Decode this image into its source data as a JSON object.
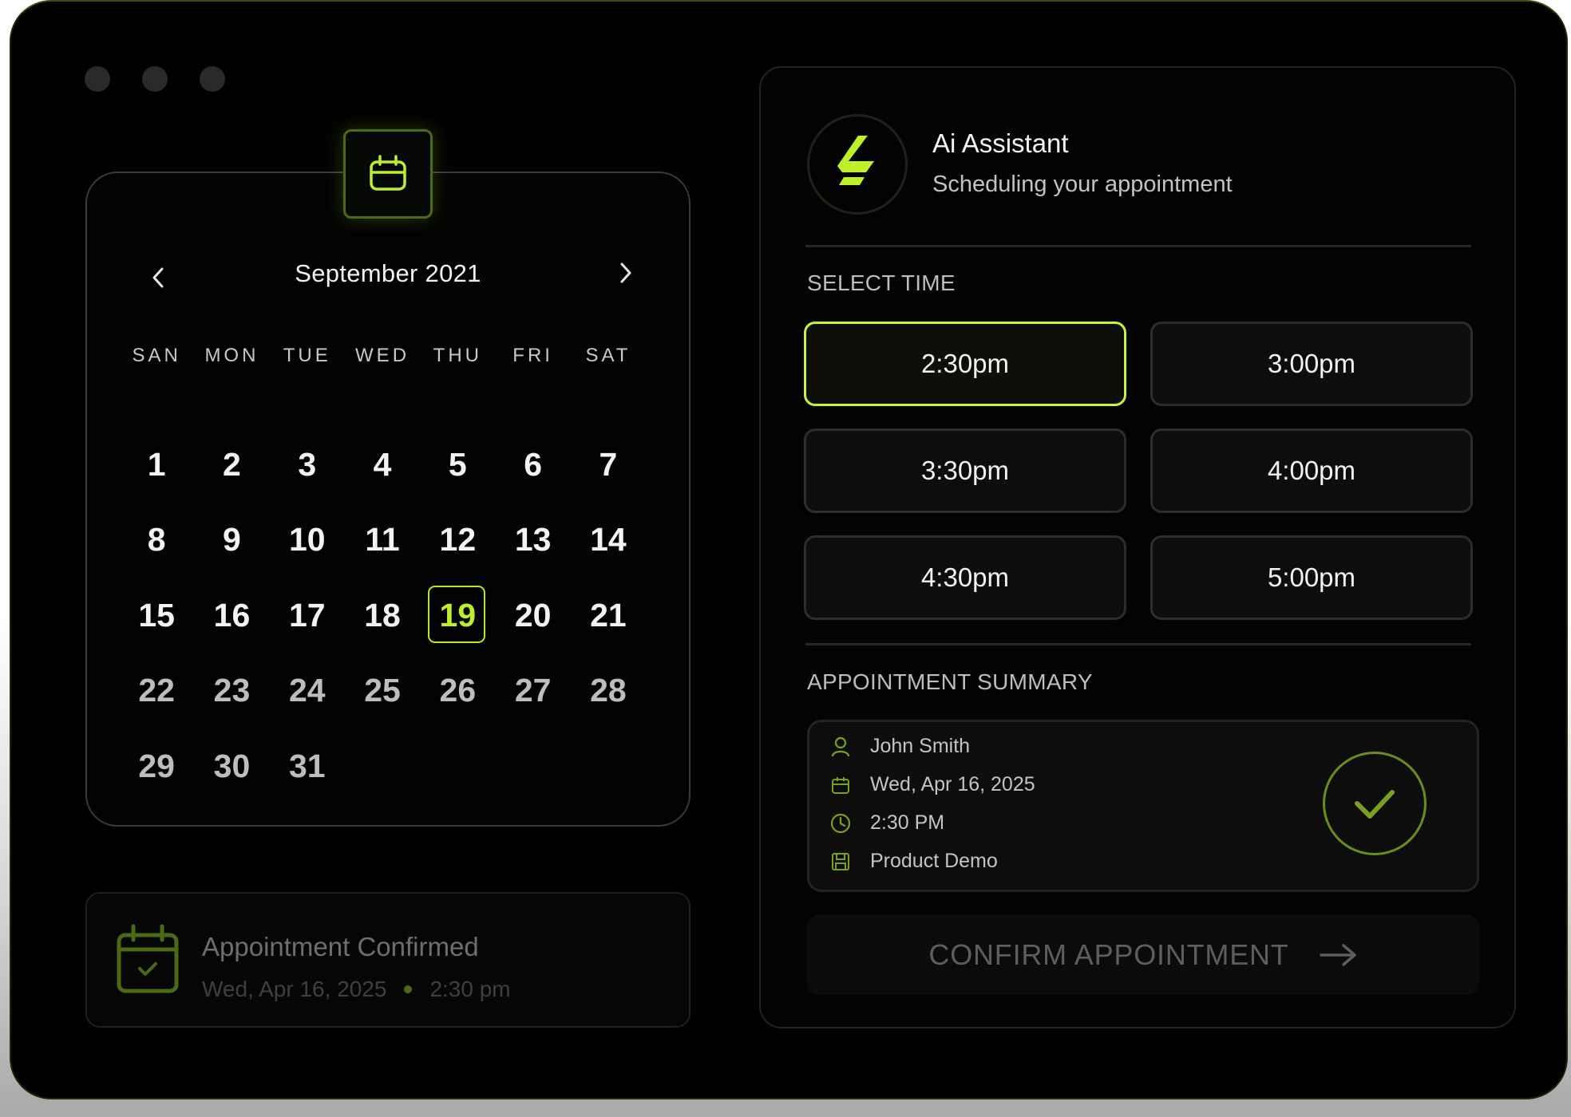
{
  "colors": {
    "accent": "#bdef2a",
    "background": "#000000"
  },
  "calendar": {
    "title": "September 2021",
    "prev_icon": "chevron-left-icon",
    "next_icon": "chevron-right-icon",
    "badge_icon": "calendar-icon",
    "weekdays": [
      "SAN",
      "MON",
      "TUE",
      "WED",
      "THU",
      "FRI",
      "SAT"
    ],
    "days": [
      "1",
      "2",
      "3",
      "4",
      "5",
      "6",
      "7",
      "8",
      "9",
      "10",
      "11",
      "12",
      "13",
      "14",
      "15",
      "16",
      "17",
      "18",
      "19",
      "20",
      "21",
      "22",
      "23",
      "24",
      "25",
      "26",
      "27",
      "28",
      "29",
      "30",
      "31"
    ],
    "selected_day": "19"
  },
  "toast": {
    "title": "Appointment Confirmed",
    "date": "Wed, Apr 16, 2025",
    "time": "2:30 pm",
    "icon": "calendar-check-icon"
  },
  "assistant": {
    "name": "Ai Assistant",
    "subtitle": "Scheduling your appointment",
    "logo_icon": "bolt-logo-icon"
  },
  "select_time": {
    "label": "SELECT TIME",
    "slots": [
      "2:30pm",
      "3:00pm",
      "3:30pm",
      "4:00pm",
      "4:30pm",
      "5:00pm"
    ],
    "selected": "2:30pm"
  },
  "summary": {
    "label": "APPOINTMENT SUMMARY",
    "name": "John Smith",
    "date": "Wed, Apr 16, 2025",
    "time": "2:30 PM",
    "type": "Product Demo"
  },
  "confirm_button": {
    "label": "CONFIRM APPOINTMENT",
    "icon": "arrow-right-icon"
  }
}
